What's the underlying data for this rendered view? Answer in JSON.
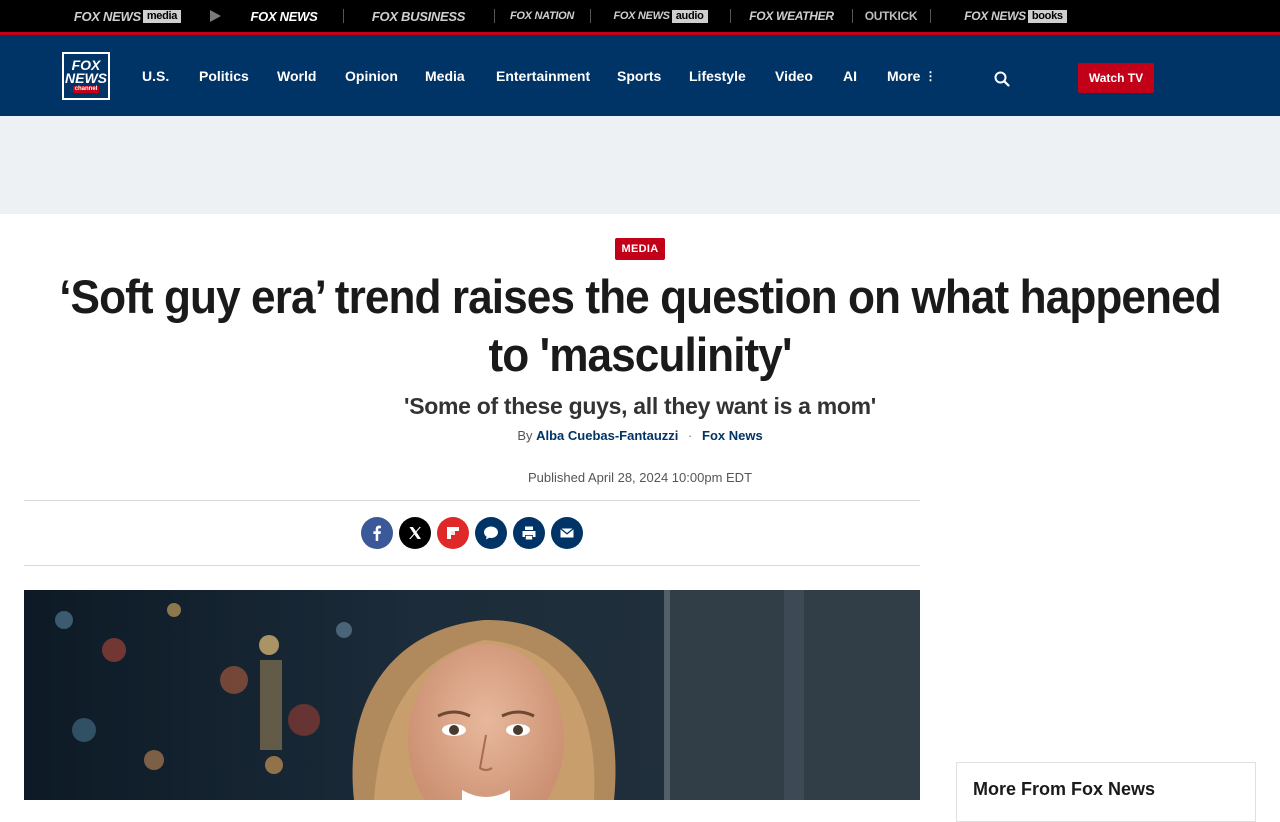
{
  "network_bar": {
    "items": [
      {
        "label": "FOX NEWS",
        "tag": "media"
      },
      {
        "label": "FOX NEWS"
      },
      {
        "label": "FOX BUSINESS"
      },
      {
        "label": "FOX NATION"
      },
      {
        "label": "FOX NEWS",
        "tag": "audio"
      },
      {
        "label": "FOX WEATHER"
      },
      {
        "label": "OUTKICK"
      },
      {
        "label": "FOX NEWS",
        "tag": "books"
      }
    ]
  },
  "logo": {
    "line1": "FOX",
    "line2": "NEWS",
    "line3": "channel"
  },
  "nav": {
    "items": [
      "U.S.",
      "Politics",
      "World",
      "Opinion",
      "Media",
      "Entertainment",
      "Sports",
      "Lifestyle",
      "Video",
      "AI",
      "More"
    ],
    "watch_tv": "Watch TV"
  },
  "article": {
    "category": "MEDIA",
    "headline": "‘Soft guy era’ trend raises the question on what happened to 'masculinity'",
    "subheadline": "'Some of these guys, all they want is a mom'",
    "by": "By",
    "author": "Alba Cuebas-Fantauzzi",
    "outlet": "Fox News",
    "published": "Published April 28, 2024 10:00pm EDT"
  },
  "share": [
    "facebook-icon",
    "x-icon",
    "flipboard-icon",
    "comments-icon",
    "print-icon",
    "email-icon"
  ],
  "sidebar": {
    "title": "More From Fox News"
  },
  "colors": {
    "brand_navy": "#003366",
    "brand_red": "#c20017",
    "ad_background": "#edf1f4"
  }
}
